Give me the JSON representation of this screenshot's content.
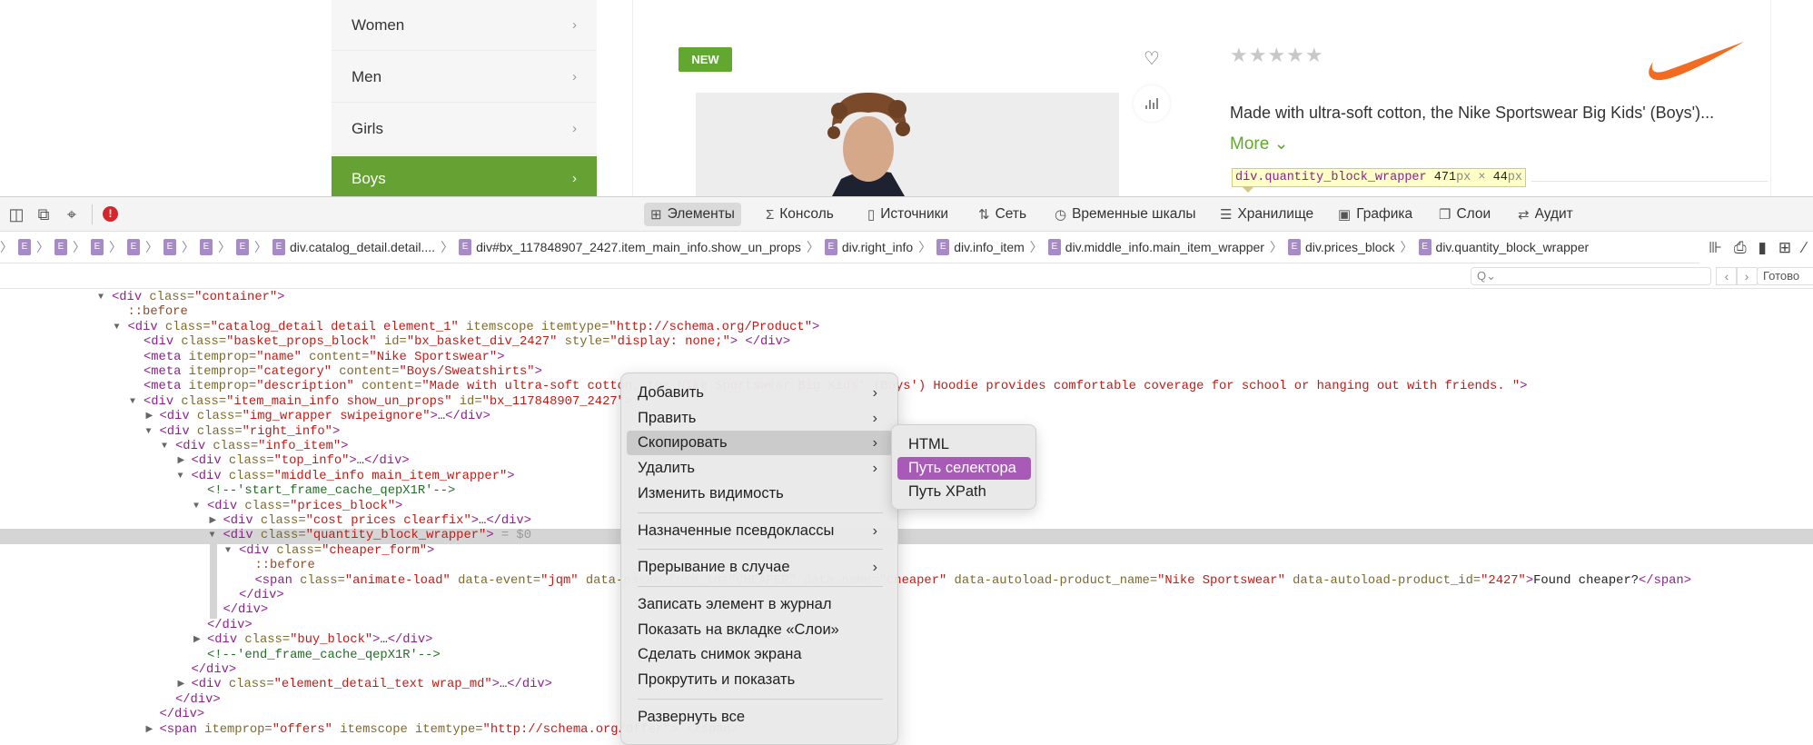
{
  "page": {
    "categories": [
      {
        "label": "Women",
        "active": false
      },
      {
        "label": "Men",
        "active": false
      },
      {
        "label": "Girls",
        "active": false
      },
      {
        "label": "Boys",
        "active": true
      }
    ],
    "badge": "NEW",
    "rating_stars": 0,
    "rating_max": 5,
    "description": "Made with ultra-soft cotton, the Nike Sportswear Big Kids' (Boys')...",
    "more_label": "More ⌄",
    "brand_color": "#f26b21",
    "accent_color": "#62a830",
    "tooltip": {
      "selector": "div.quantity_block_wrapper",
      "width": "471",
      "height": "44",
      "unit": "px",
      "times": "×"
    }
  },
  "devtools": {
    "tabs": [
      {
        "label": "Элементы",
        "icon": "elements-icon",
        "glyph": "⊞",
        "selected": true
      },
      {
        "label": "Консоль",
        "icon": "console-icon",
        "glyph": "Σ",
        "selected": false
      },
      {
        "label": "Источники",
        "icon": "sources-icon",
        "glyph": "▯",
        "selected": false
      },
      {
        "label": "Сеть",
        "icon": "network-icon",
        "glyph": "⇅",
        "selected": false
      },
      {
        "label": "Временные шкалы",
        "icon": "timelines-icon",
        "glyph": "◷",
        "selected": false
      },
      {
        "label": "Хранилище",
        "icon": "storage-icon",
        "glyph": "☰",
        "selected": false
      },
      {
        "label": "Графика",
        "icon": "graphics-icon",
        "glyph": "▣",
        "selected": false
      },
      {
        "label": "Слои",
        "icon": "layers-icon",
        "glyph": "❐",
        "selected": false
      },
      {
        "label": "Аудит",
        "icon": "audit-icon",
        "glyph": "⇄",
        "selected": false
      }
    ],
    "error_glyph": "!",
    "breadcrumb_badge": "E",
    "breadcrumbs": [
      "",
      "",
      "",
      "",
      "",
      "",
      "",
      "div.catalog_detail.detail....",
      "div#bx_117848907_2427.item_main_info.show_un_props",
      "div.right_info",
      "div.info_item",
      "div.middle_info.main_item_wrapper",
      "div.prices_block",
      "div.quantity_block_wrapper"
    ],
    "filter_placeholder": "Q⌄",
    "prev": "‹",
    "next": "›",
    "done_label": "Готово",
    "selected_line": 16,
    "code_lines": [
      {
        "level": 0,
        "toggle": "open",
        "text": "<div class=\"container\">"
      },
      {
        "level": 1,
        "toggle": null,
        "text": "::before"
      },
      {
        "level": 1,
        "toggle": "open",
        "text": "<div class=\"catalog_detail detail element_1\" itemscope itemtype=\"http://schema.org/Product\">"
      },
      {
        "level": 2,
        "toggle": null,
        "text": "<div class=\"basket_props_block\" id=\"bx_basket_div_2427\" style=\"display: none;\"> </div>"
      },
      {
        "level": 2,
        "toggle": null,
        "text": "<meta itemprop=\"name\" content=\"Nike Sportswear\">"
      },
      {
        "level": 2,
        "toggle": null,
        "text": "<meta itemprop=\"category\" content=\"Boys/Sweatshirts\">"
      },
      {
        "level": 2,
        "toggle": null,
        "text": "<meta itemprop=\"description\" content=\"Made with ultra-soft cotton, the Nike Sportswear Big Kids' (Boys') Hoodie provides comfortable coverage for school or hanging out with friends. \">"
      },
      {
        "level": 2,
        "toggle": "open",
        "text": "<div class=\"item_main_info show_un_props\" id=\"bx_117848907_2427\">"
      },
      {
        "level": 3,
        "toggle": "closed",
        "text": "<div class=\"img_wrapper swipeignore\">…</div>"
      },
      {
        "level": 3,
        "toggle": "open",
        "text": "<div class=\"right_info\">"
      },
      {
        "level": 4,
        "toggle": "open",
        "text": "<div class=\"info_item\">"
      },
      {
        "level": 5,
        "toggle": "closed",
        "text": "<div class=\"top_info\">…</div>"
      },
      {
        "level": 5,
        "toggle": "open",
        "text": "<div class=\"middle_info main_item_wrapper\">"
      },
      {
        "level": 6,
        "toggle": null,
        "text": "<!--'start_frame_cache_qepX1R'-->"
      },
      {
        "level": 6,
        "toggle": "open",
        "text": "<div class=\"prices_block\">"
      },
      {
        "level": 7,
        "toggle": "closed",
        "text": "<div class=\"cost prices clearfix\">…</div>"
      },
      {
        "level": 7,
        "toggle": "open",
        "text": "<div class=\"quantity_block_wrapper\">",
        "suffix": " = $0"
      },
      {
        "level": 8,
        "toggle": "open",
        "text": "<div class=\"cheaper_form\">"
      },
      {
        "level": 9,
        "toggle": null,
        "text": "::before"
      },
      {
        "level": 9,
        "toggle": null,
        "text": "<span class=\"animate-load\" data-event=\"jqm\" data-param-form_id=\"CHEAPER\" data-name=\"cheaper\" data-autoload-product_name=\"Nike Sportswear\" data-autoload-product_id=\"2427\">Found cheaper?</span>"
      },
      {
        "level": 8,
        "toggle": null,
        "text": "</div>"
      },
      {
        "level": 7,
        "toggle": null,
        "text": "</div>"
      },
      {
        "level": 6,
        "toggle": null,
        "text": "</div>"
      },
      {
        "level": 6,
        "toggle": "closed",
        "text": "<div class=\"buy_block\">…</div>"
      },
      {
        "level": 6,
        "toggle": null,
        "text": "<!--'end_frame_cache_qepX1R'-->"
      },
      {
        "level": 5,
        "toggle": null,
        "text": "</div>"
      },
      {
        "level": 5,
        "toggle": "closed",
        "text": "<div class=\"element_detail_text wrap_md\">…</div>"
      },
      {
        "level": 4,
        "toggle": null,
        "text": "</div>"
      },
      {
        "level": 3,
        "toggle": null,
        "text": "</div>"
      },
      {
        "level": 3,
        "toggle": "closed",
        "text": "<span itemprop=\"offers\" itemscope itemtype=\"http://schema.org/Offer\"> </span>"
      }
    ]
  },
  "context_menu": {
    "items": [
      {
        "label": "Добавить",
        "submenu": true
      },
      {
        "label": "Править",
        "submenu": true
      },
      {
        "label": "Скопировать",
        "submenu": true,
        "hover": true
      },
      {
        "label": "Удалить",
        "submenu": true
      },
      {
        "label": "Изменить видимость",
        "submenu": false
      },
      {
        "separator": true
      },
      {
        "label": "Назначенные псевдоклассы",
        "submenu": true
      },
      {
        "separator": true
      },
      {
        "label": "Прерывание в случае",
        "submenu": true
      },
      {
        "separator": true
      },
      {
        "label": "Записать элемент в журнал",
        "submenu": false
      },
      {
        "label": "Показать на вкладке «Слои»",
        "submenu": false
      },
      {
        "label": "Сделать снимок экрана",
        "submenu": false
      },
      {
        "label": "Прокрутить и показать",
        "submenu": false
      },
      {
        "separator": true
      },
      {
        "label": "Развернуть все",
        "submenu": false
      }
    ],
    "copy_submenu": [
      {
        "label": "HTML",
        "active": false
      },
      {
        "label": "Путь селектора",
        "active": true
      },
      {
        "label": "Путь XPath",
        "active": false
      }
    ]
  }
}
